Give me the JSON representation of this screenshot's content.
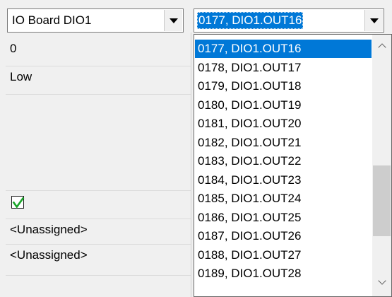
{
  "left_combo": {
    "value": "IO Board DIO1",
    "dropdown_icon": "chevron-down-icon"
  },
  "right_combo": {
    "value": "0177, DIO1.OUT16",
    "dropdown_icon": "chevron-down-icon"
  },
  "properties": [
    {
      "value": "0"
    },
    {
      "value": "Low"
    },
    {
      "value": ""
    },
    {
      "value": "",
      "checked": true
    },
    {
      "value": "<Unassigned>"
    },
    {
      "value": "<Unassigned>"
    }
  ],
  "dropdown": {
    "items": [
      "0177, DIO1.OUT16",
      "0178, DIO1.OUT17",
      "0179, DIO1.OUT18",
      "0180, DIO1.OUT19",
      "0181, DIO1.OUT20",
      "0182, DIO1.OUT21",
      "0183, DIO1.OUT22",
      "0184, DIO1.OUT23",
      "0185, DIO1.OUT24",
      "0186, DIO1.OUT25",
      "0187, DIO1.OUT26",
      "0188, DIO1.OUT27",
      "0189, DIO1.OUT28"
    ],
    "selected_index": 0,
    "scroll_position_fraction": 0.75
  },
  "colors": {
    "selection": "#0078d7",
    "checkmark": "#1aa52a"
  }
}
